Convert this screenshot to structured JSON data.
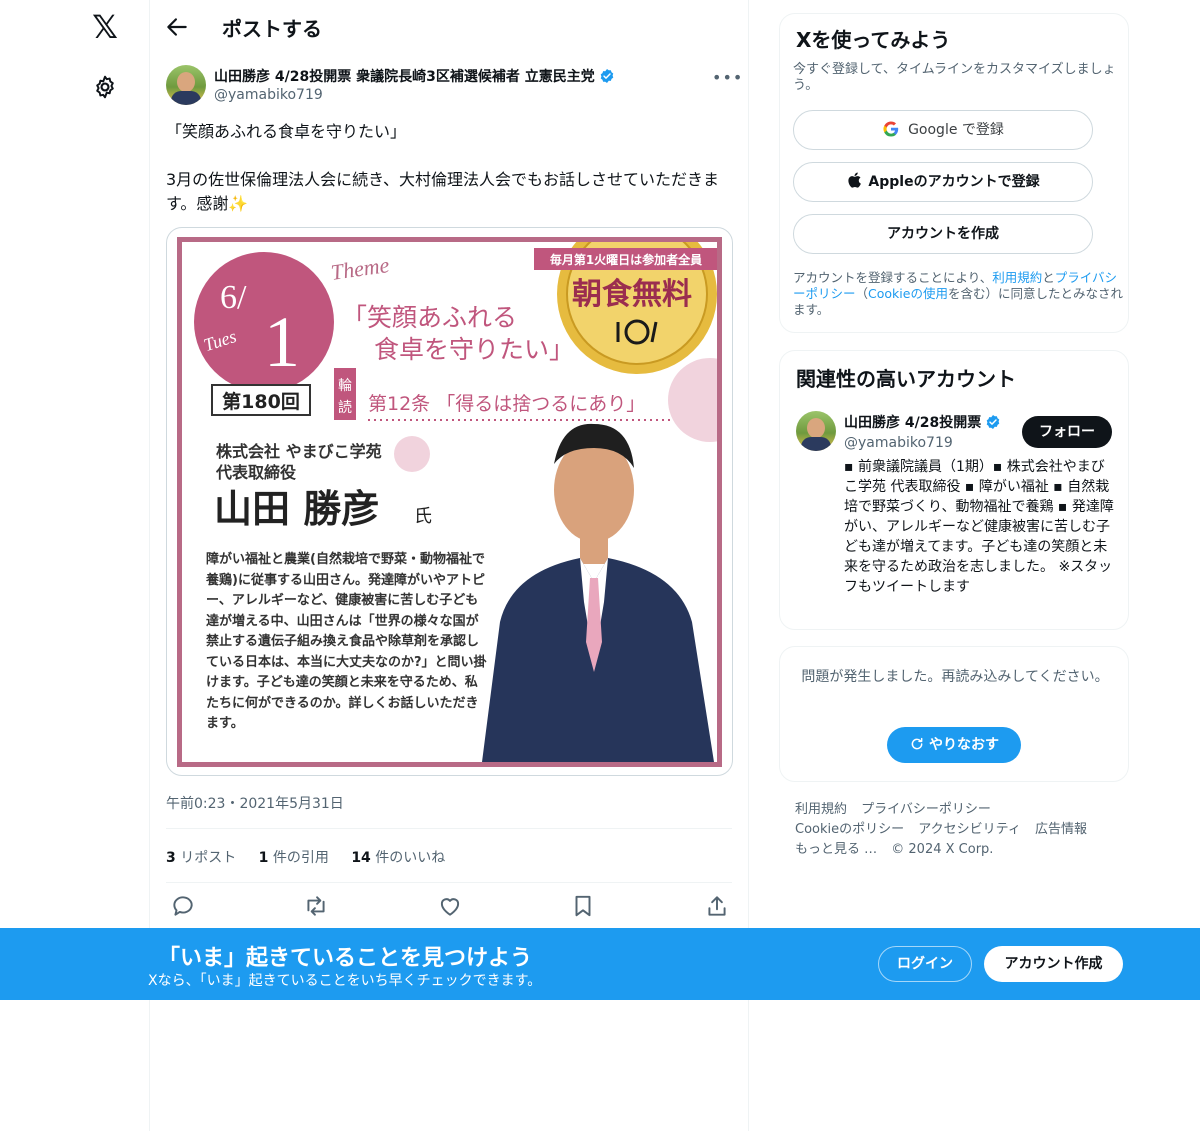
{
  "header": {
    "title": "ポストする"
  },
  "tweet": {
    "author_name": "山田勝彦 4/28投開票 衆議院長崎3区補選候補者 立憲民主党",
    "author_handle": "@yamabiko719",
    "text": "「笑顔あふれる食卓を守りたい」\n\n3月の佐世保倫理法人会に続き、大村倫理法人会でもお話しさせていただきます。感謝✨",
    "timestamp": "午前0:23・2021年5月31日",
    "stats": {
      "reposts_count": "3",
      "reposts_label": " リポスト",
      "quotes_count": "1",
      "quotes_label": " 件の引用",
      "likes_count": "14",
      "likes_label": " 件のいいね"
    }
  },
  "poster": {
    "month": "6/",
    "weekday": "Tues",
    "day": "1",
    "theme_script": "Theme",
    "theme_line1": "「笑顔あふれる",
    "theme_line2": "食卓を守りたい」",
    "seal_top": "毎月第1火曜日は参加者全員",
    "seal_main": "朝食無料",
    "session": "第180回",
    "reading_tag_1": "輪",
    "reading_tag_2": "読",
    "reading": "第12条 「得るは捨つるにあり」",
    "company_line1": "株式会社 やまびこ学苑",
    "company_line2": "代表取締役",
    "speaker_name": "山田 勝彦",
    "speaker_suffix": "氏",
    "description": "障がい福祉と農業(自然栽培で野菜・動物福祉で養鶏)に従事する山田さん。発達障がいやアトピー、アレルギーなど、健康被害に苦しむ子ども達が増える中、山田さんは「世界の様々な国が禁止する遺伝子組み換え食品や除草剤を承認している日本は、本当に大丈夫なのか?」と問い掛けます。子ども達の笑顔と未来を守るため、私たちに何ができるのか。詳しくお話しいただきます。"
  },
  "signup_card": {
    "title": "Xを使ってみよう",
    "subtitle": "今すぐ登録して、タイムラインをカスタマイズしましょう。",
    "google_label": "Google で登録",
    "apple_label": "Appleのアカウントで登録",
    "create_label": "アカウントを作成",
    "legal_1": "アカウントを登録することにより、",
    "legal_terms": "利用規約",
    "legal_2": "と",
    "legal_privacy": "プライバシーポリシー",
    "legal_3": "（",
    "legal_cookie": "Cookieの使用",
    "legal_4": "を含む）に同意したとみなされます。"
  },
  "related_card": {
    "title": "関連性の高いアカウント",
    "name": "山田勝彦 4/28投開票",
    "handle": "@yamabiko719",
    "follow_label": "フォロー",
    "bio": "▪ 前衆議院議員（1期）▪ 株式会社やまびこ学苑 代表取締役 ▪ 障がい福祉 ▪ 自然栽培で野菜づくり、動物福祉で養鶏 ▪ 発達障がい、アレルギーなど健康被害に苦しむ子ども達が増えてます。子ども達の笑顔と未来を守るため政治を志しました。 ※スタッフもツイートします"
  },
  "error_card": {
    "message": "問題が発生しました。再読み込みしてください。",
    "retry_label": "やりなおす"
  },
  "footer": {
    "links": [
      "利用規約",
      "プライバシーポリシー",
      "Cookieのポリシー",
      "アクセシビリティ",
      "広告情報",
      "もっと見る …"
    ],
    "copyright": "© 2024 X Corp."
  },
  "banner": {
    "title": "「いま」起きていることを見つけよう",
    "subtitle": "Xなら、「いま」起きていることをいち早くチェックできます。",
    "login_label": "ログイン",
    "signup_label": "アカウント作成"
  },
  "colors": {
    "accent": "#1d9bf0",
    "poster_frame": "#b86a86",
    "poster_circle": "#c0567d",
    "text_primary": "#0f1419",
    "text_secondary": "#536471"
  },
  "icons": {
    "logo": "x-logo-icon",
    "settings": "gear-icon",
    "back": "back-arrow-icon",
    "verified": "verified-badge-icon",
    "more": "more-dots-icon",
    "reply": "reply-icon",
    "repost": "repost-icon",
    "like": "heart-icon",
    "bookmark": "bookmark-icon",
    "share": "share-icon",
    "google": "google-icon",
    "apple": "apple-icon",
    "retry": "refresh-icon"
  }
}
